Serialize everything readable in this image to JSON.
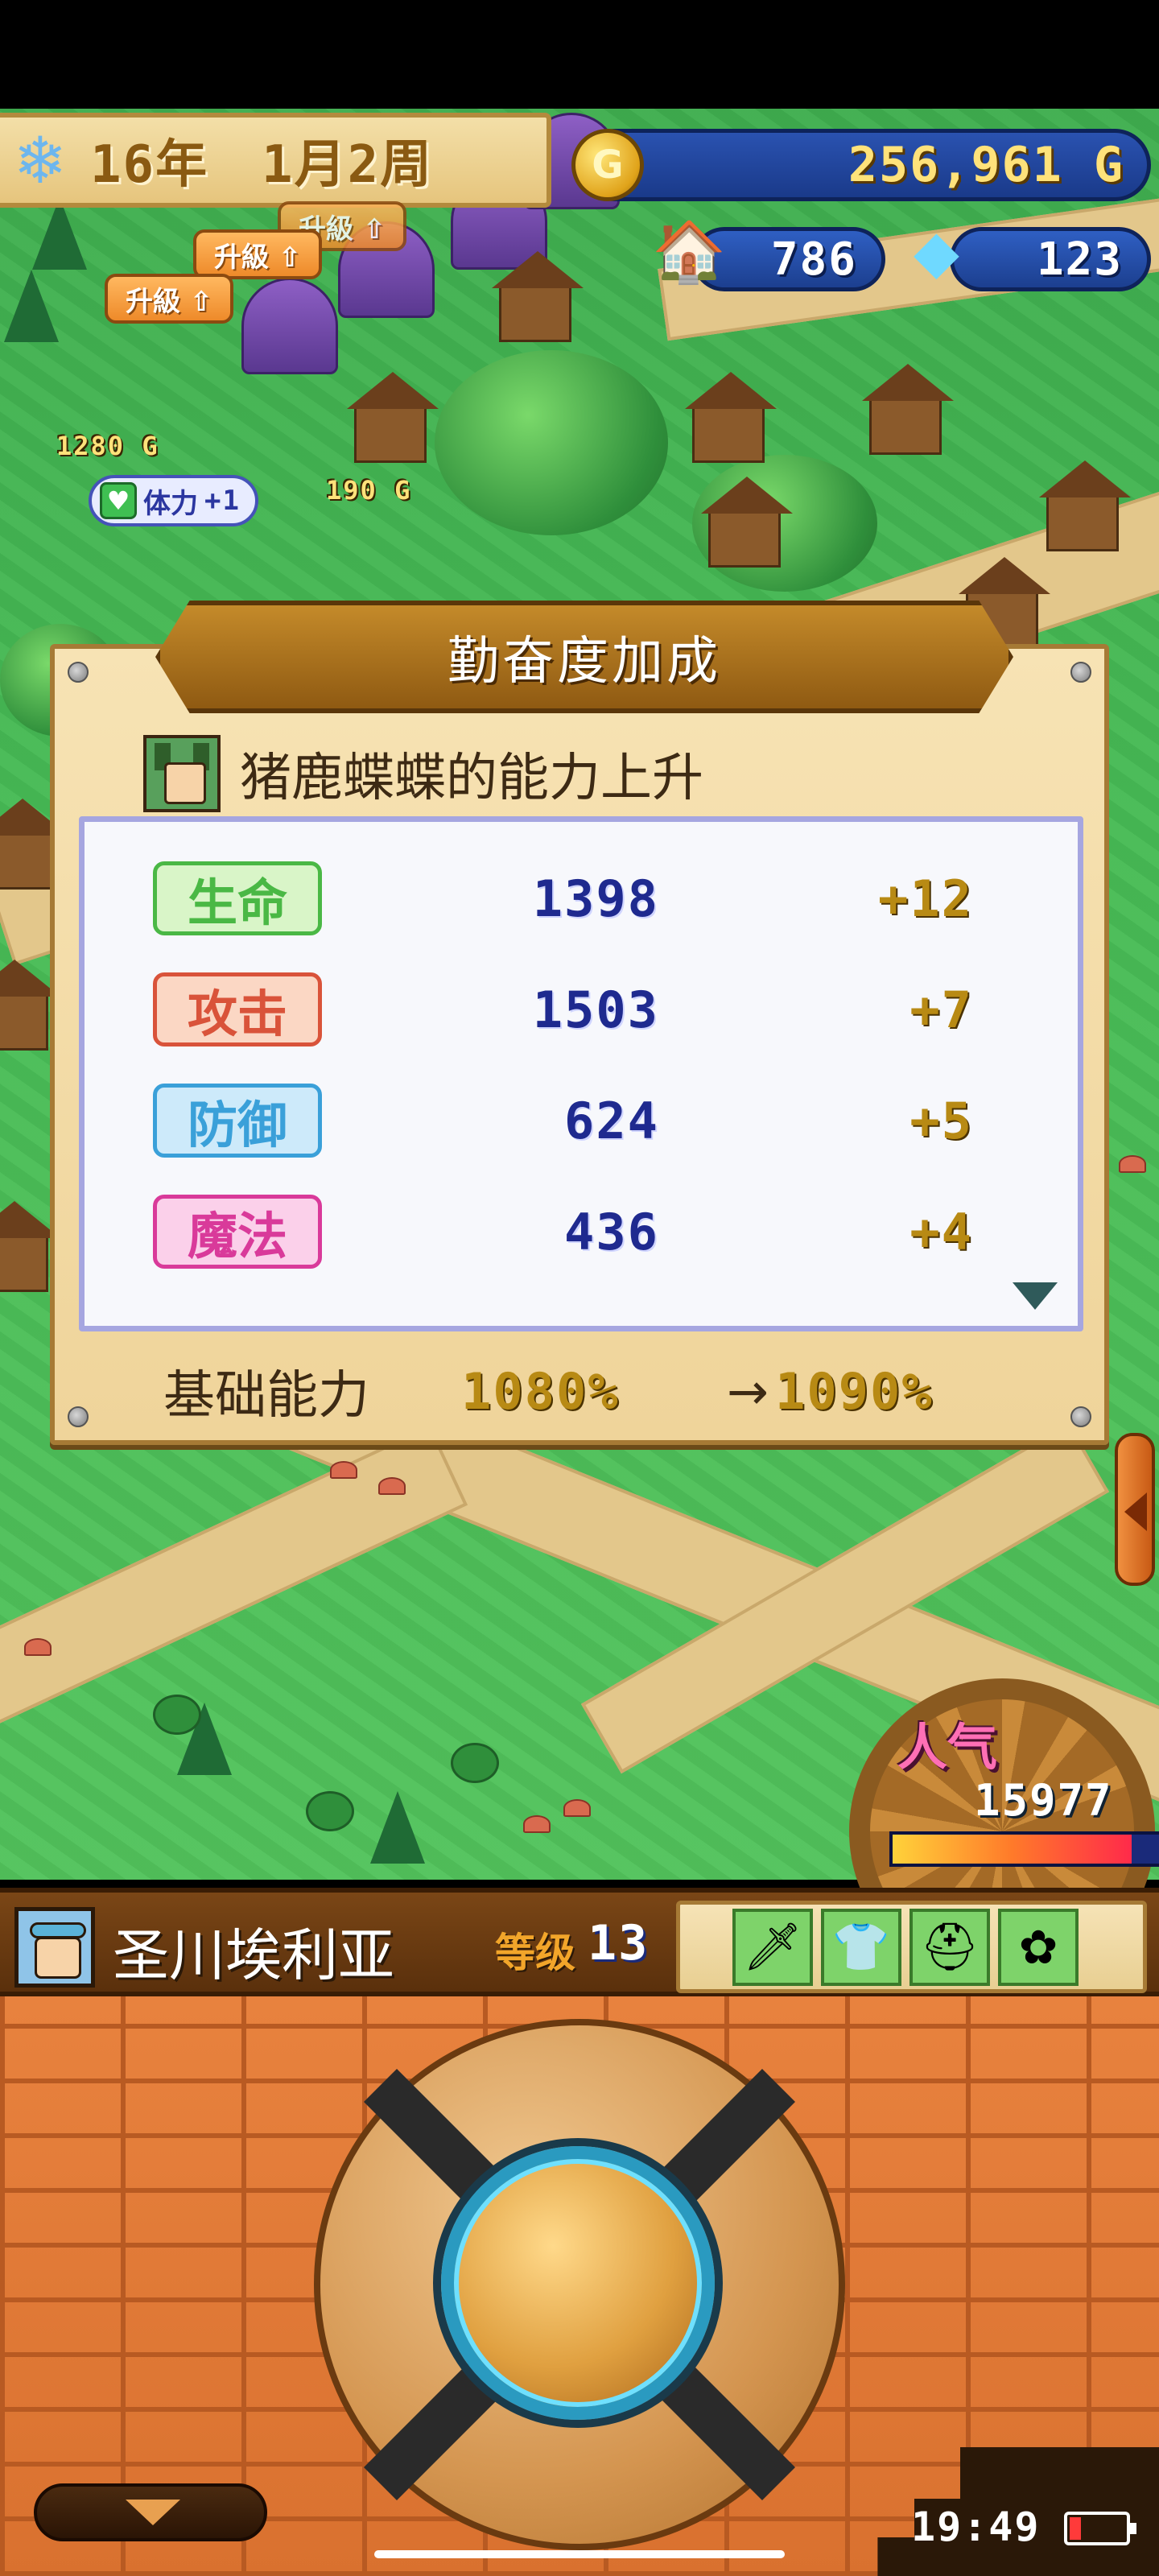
{
  "hud": {
    "date": "16年　1月2周",
    "gold": "256,961 G",
    "gold_coin_label": "G",
    "houses": "786",
    "crystals": "123"
  },
  "map": {
    "upgrade_labels": [
      "升級 ⇧",
      "升級 ⇧"
    ],
    "upgrade_label_partial": "升級 ⇧",
    "price_castle": "1280 G",
    "price_shop": "190 G",
    "stamina_label": "体力",
    "stamina_value": "+1"
  },
  "modal": {
    "title": "勤奋度加成",
    "subtitle": "猪鹿蝶蝶的能力上升",
    "stats": [
      {
        "label": "生命",
        "value": "1398",
        "bonus": "+12",
        "color": "#4ab845"
      },
      {
        "label": "攻击",
        "value": "1503",
        "bonus": "+7",
        "color": "#d9533a"
      },
      {
        "label": "防御",
        "value": "624",
        "bonus": "+5",
        "color": "#3aa0d9"
      },
      {
        "label": "魔法",
        "value": "436",
        "bonus": "+4",
        "color": "#d93a9a"
      }
    ],
    "base_label": "基础能力",
    "base_from": "1080%",
    "base_arrow": "→",
    "base_to": "1090%"
  },
  "popularity": {
    "label": "人气",
    "value": "15977",
    "bar_fill_percent": 82
  },
  "character": {
    "name": "圣川埃利亚",
    "level_label": "等级",
    "level": "13",
    "equipment": [
      "sword",
      "armor",
      "helmet",
      "flower-accessory"
    ]
  },
  "system": {
    "clock": "19:49"
  }
}
